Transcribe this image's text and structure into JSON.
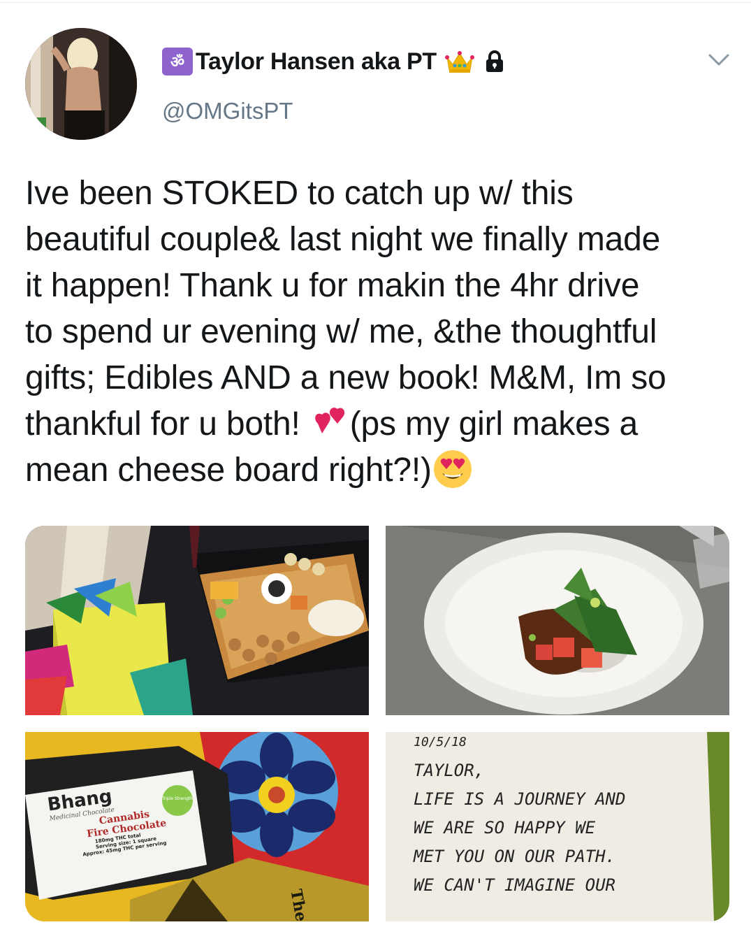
{
  "user": {
    "badge_glyph": "ॐ",
    "display_name": "Taylor Hansen aka PT",
    "handle": "@OMGitsPT",
    "badge_color": "#8e63ce",
    "icons": [
      "om-icon",
      "crown-icon",
      "lock-icon",
      "chevron-down-icon"
    ]
  },
  "tweet": {
    "lines": [
      "Ive been STOKED to catch up w/ this",
      "beautiful couple& last night we finally made",
      "it happen! Thank u for makin the 4hr drive",
      "to spend ur evening w/ me, &the thoughtful",
      "gifts; Edibles AND a new book! M&M, Im so",
      "thankful for u both! ",
      "(ps my girl makes a",
      "mean cheese board right?!)"
    ],
    "emojis": [
      "two-hearts-icon",
      "heart-eyes-icon"
    ]
  },
  "media": {
    "photos": [
      "photo-gift-and-cheese-board",
      "photo-plated-dish",
      "photo-cannabis-chocolate",
      "photo-handwritten-note"
    ],
    "chocolate_label": {
      "brand": "Bhang",
      "subtitle": "Medicinal Chocolate",
      "badge": "Triple Strength",
      "product_line1": "Cannabis",
      "product_line2": "Fire Chocolate",
      "detail1": "180mg THC total",
      "detail2": "Serving size: 1 square",
      "detail3": "Approx: 45mg THC per serving",
      "box_text": "The"
    },
    "note": {
      "line1": "10/5/18",
      "line2": "TAYLOR,",
      "line3": "LIFE IS A JOURNEY AND",
      "line4": "WE ARE SO HAPPY WE",
      "line5": "MET YOU ON OUR PATH.",
      "line6": "WE CAN'T IMAGINE OUR"
    }
  }
}
